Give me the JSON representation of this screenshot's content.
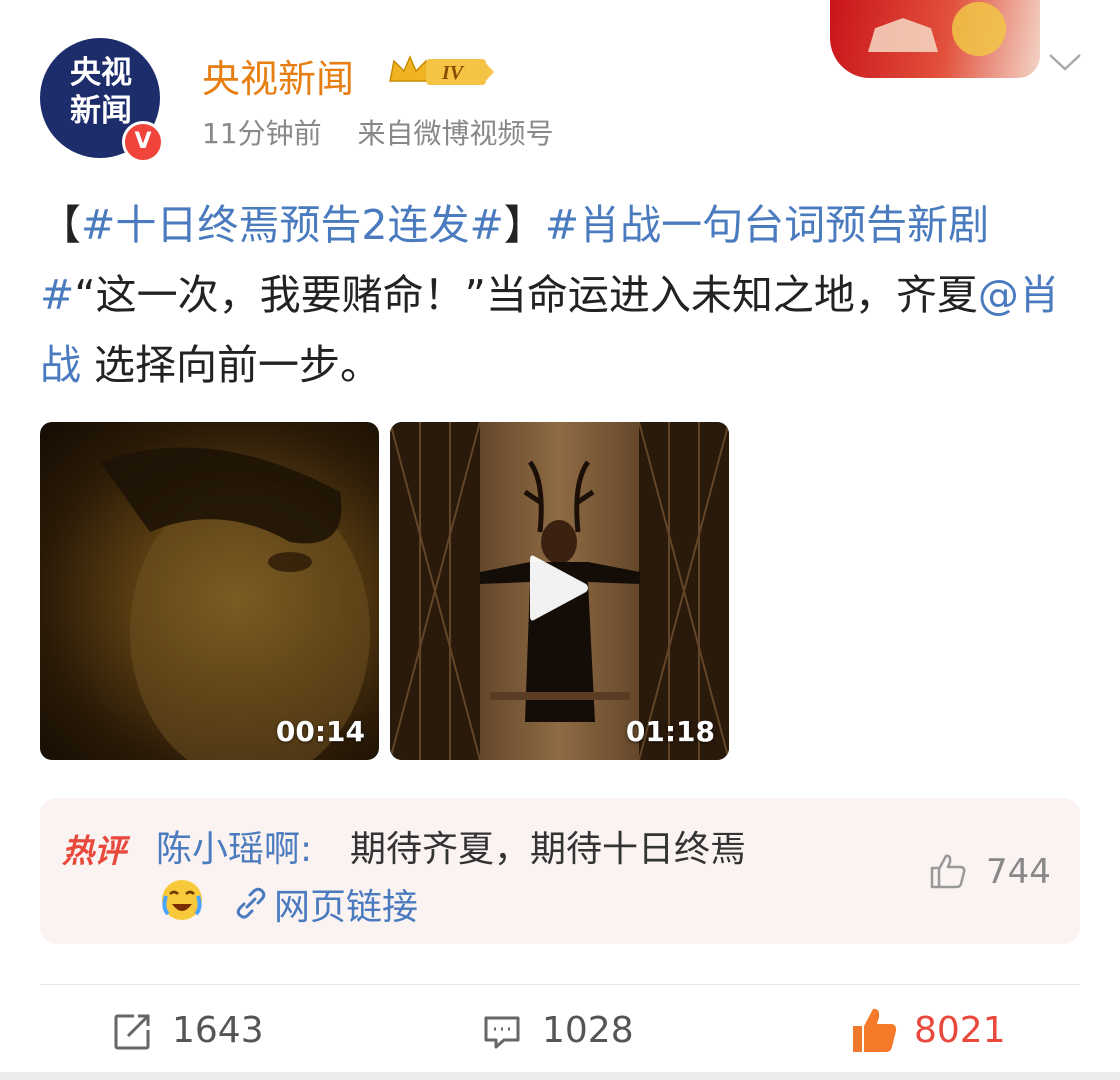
{
  "header": {
    "avatar_text": "央视\n新闻",
    "verified_badge": "V",
    "username": "央视新闻",
    "vip_level": "IV",
    "time": "11分钟前",
    "source": "来自微博视频号"
  },
  "post": {
    "segments": [
      {
        "text": "【",
        "type": "plain"
      },
      {
        "text": "#十日终焉预告2连发#",
        "type": "link"
      },
      {
        "text": "】",
        "type": "plain"
      },
      {
        "text": "#肖战一句台词预告新剧#",
        "type": "link"
      },
      {
        "text": "“这一次，我要赌命！”当命运进入未知之地，齐夏",
        "type": "plain"
      },
      {
        "text": "@肖战",
        "type": "link"
      },
      {
        "text": " 选择向前一步。",
        "type": "plain"
      }
    ]
  },
  "media": [
    {
      "duration": "00:14"
    },
    {
      "duration": "01:18"
    }
  ],
  "hot_comment": {
    "tag": "热评",
    "user": "陈小瑶啊:",
    "text": "期待齐夏，期待十日终焉",
    "link_text": "网页链接",
    "likes": "744"
  },
  "actions": {
    "repost": "1643",
    "comment": "1028",
    "like": "8021"
  },
  "colors": {
    "name_orange": "#e67e12",
    "link_blue": "#4b7bbf",
    "hot_red": "#e8493c"
  },
  "icons": [
    "vip-crown-icon",
    "chevron-down-icon",
    "play-icon",
    "emoji-crying-laugh-icon",
    "link-icon",
    "thumb-up-icon",
    "repost-icon",
    "comment-icon",
    "like-icon"
  ]
}
